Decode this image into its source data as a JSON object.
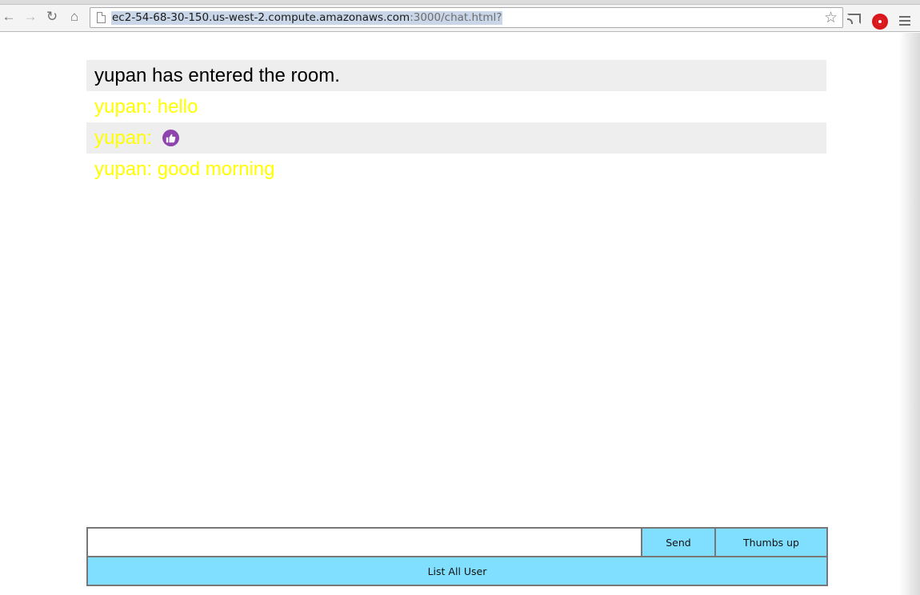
{
  "browser": {
    "url_host": "ec2-54-68-30-150.us-west-2.compute.amazonaws.com",
    "url_path": ":3000/chat.html?",
    "icons": [
      "back-icon",
      "forward-icon",
      "reload-icon",
      "home-icon",
      "bookmark-star-icon",
      "cast-icon",
      "stop-extension-icon",
      "menu-icon"
    ]
  },
  "chat": {
    "messages": [
      {
        "text": "yupan has entered the room.",
        "kind": "system"
      },
      {
        "text": "yupan: hello",
        "kind": "user"
      },
      {
        "text": "yupan: ",
        "kind": "user",
        "icon": "thumbs-up-icon"
      },
      {
        "text": "yupan: good morning",
        "kind": "user"
      }
    ],
    "colors": {
      "system_text": "#000000",
      "user_text": "#ffff00",
      "stripe": "#eeeeee",
      "thumb_icon": "#8e44ad"
    }
  },
  "form": {
    "input_value": "",
    "send_label": "Send",
    "thumbs_label": "Thumbs up",
    "list_label": "List All User",
    "button_color": "#80dfff"
  }
}
